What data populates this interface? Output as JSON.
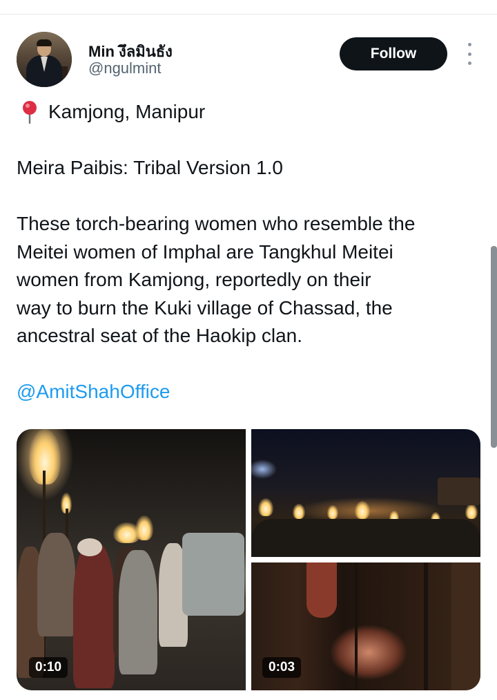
{
  "author": {
    "display_name": "Min งึลมินธัง",
    "handle": "@ngulmint"
  },
  "actions": {
    "follow_label": "Follow",
    "more_icon": "more-vertical-icon"
  },
  "tweet": {
    "location_icon": "map-pin-icon",
    "location": "Kamjong, Manipur",
    "heading": "Meira Paibis: Tribal Version 1.0",
    "body_lines": [
      "These torch-bearing women who resemble the",
      "Meitei  women of Imphal are Tangkhul Meitei",
      "women from Kamjong, reportedly on their",
      "way to burn the Kuki village of Chassad, the",
      "ancestral seat of the Haokip clan."
    ],
    "mention": "@AmitShahOffice"
  },
  "media": [
    {
      "kind": "video",
      "duration": "0:10"
    },
    {
      "kind": "image",
      "duration": ""
    },
    {
      "kind": "video",
      "duration": "0:03"
    }
  ],
  "colors": {
    "link": "#1d9bf0",
    "follow_bg": "#0f1419",
    "secondary_text": "#536471"
  }
}
